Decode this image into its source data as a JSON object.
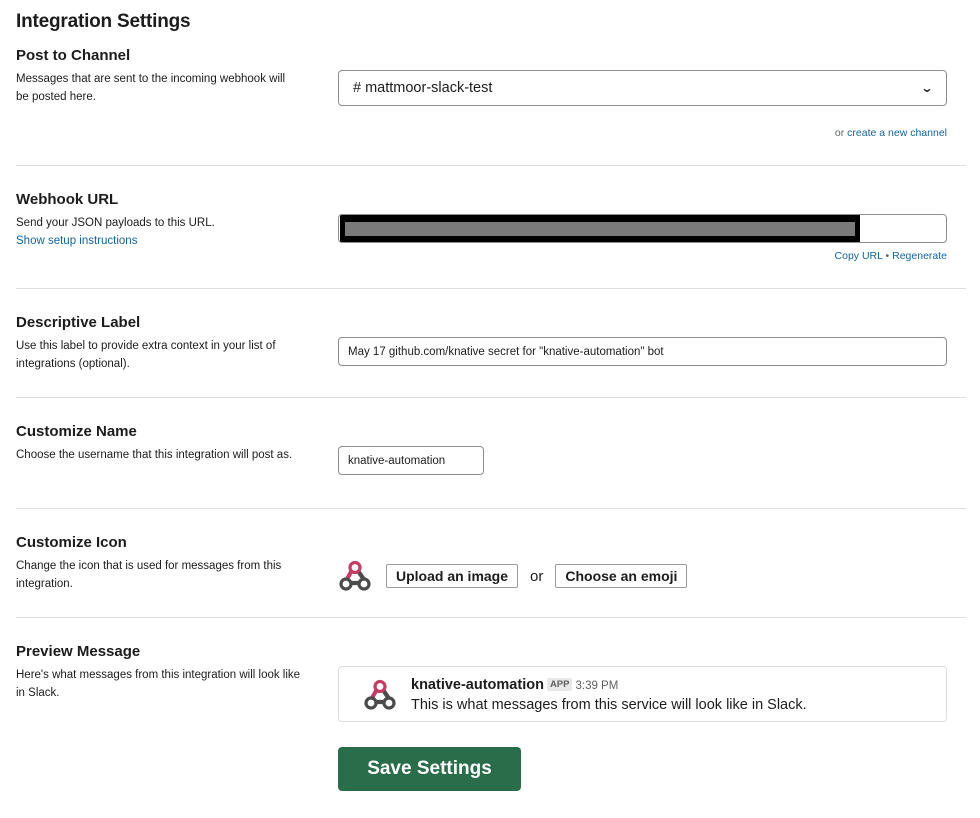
{
  "page": {
    "title": "Integration Settings"
  },
  "post_to_channel": {
    "title": "Post to Channel",
    "description": "Messages that are sent to the incoming webhook will be posted here.",
    "selected_channel": "# mattmoor-slack-test",
    "or_text": "or",
    "create_channel_link": "create a new channel"
  },
  "webhook_url": {
    "title": "Webhook URL",
    "description": "Send your JSON payloads to this URL.",
    "setup_link": "Show setup instructions",
    "value_redacted": true,
    "copy_link": "Copy URL",
    "separator": "•",
    "regenerate_link": "Regenerate"
  },
  "descriptive_label": {
    "title": "Descriptive Label",
    "description": "Use this label to provide extra context in your list of integrations (optional).",
    "value": "May 17 github.com/knative secret for \"knative-automation\" bot"
  },
  "customize_name": {
    "title": "Customize Name",
    "description": "Choose the username that this integration will post as.",
    "value": "knative-automation"
  },
  "customize_icon": {
    "title": "Customize Icon",
    "description": "Change the icon that is used for messages from this integration.",
    "icon": "webhook-icon",
    "upload_label": "Upload an image",
    "or_text": "or",
    "emoji_label": "Choose an emoji"
  },
  "preview_message": {
    "title": "Preview Message",
    "description": "Here's what messages from this integration will look like in Slack.",
    "sender": "knative-automation",
    "badge": "APP",
    "time": "3:39 PM",
    "text": "This is what messages from this service will look like in Slack."
  },
  "save_button": {
    "label": "Save Settings"
  },
  "colors": {
    "link": "#1264a3",
    "save_button": "#2a6d4a",
    "webhook_icon_pink": "#c73a63",
    "divider": "#dddddd"
  }
}
